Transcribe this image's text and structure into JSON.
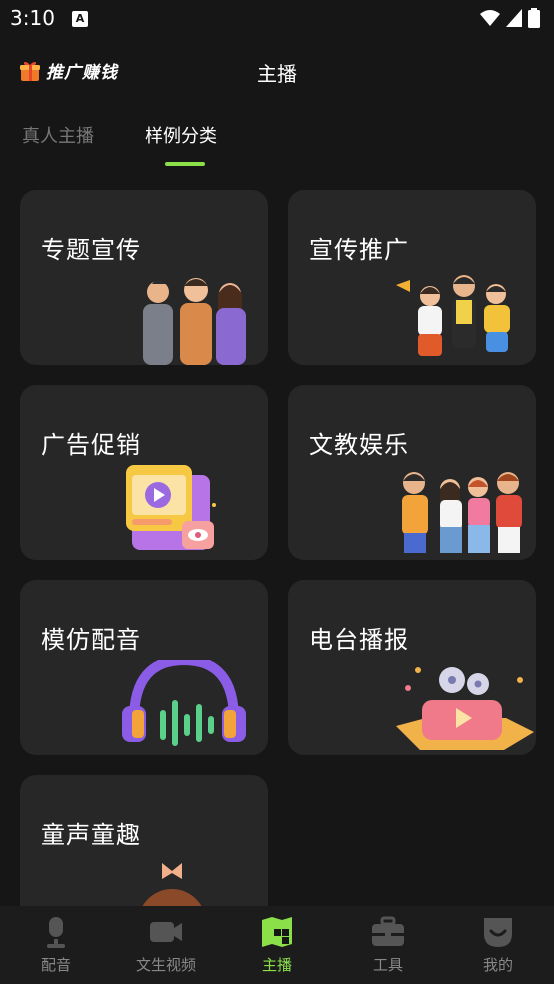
{
  "status": {
    "time": "3:10",
    "a_icon": "A"
  },
  "header": {
    "brand": "推广赚钱",
    "title": "主播"
  },
  "tabs": {
    "real": "真人主播",
    "sample": "样例分类"
  },
  "cards": [
    {
      "title": "专题宣传",
      "art": "people-group-art"
    },
    {
      "title": "宣传推广",
      "art": "promo-people-art"
    },
    {
      "title": "广告促销",
      "art": "video-ad-art"
    },
    {
      "title": "文教娱乐",
      "art": "kids-group-art"
    },
    {
      "title": "模仿配音",
      "art": "headphones-art"
    },
    {
      "title": "电台播报",
      "art": "film-box-art"
    },
    {
      "title": "童声童趣",
      "art": "child-art"
    }
  ],
  "tabbar": {
    "items": [
      {
        "label": "配音",
        "icon": "microphone-icon"
      },
      {
        "label": "文生视频",
        "icon": "video-camera-icon"
      },
      {
        "label": "主播",
        "icon": "map-book-icon",
        "active": true
      },
      {
        "label": "工具",
        "icon": "toolbox-icon"
      },
      {
        "label": "我的",
        "icon": "profile-icon"
      }
    ]
  },
  "colors": {
    "accent": "#8be04a",
    "background": "#161616",
    "card": "#272727"
  }
}
